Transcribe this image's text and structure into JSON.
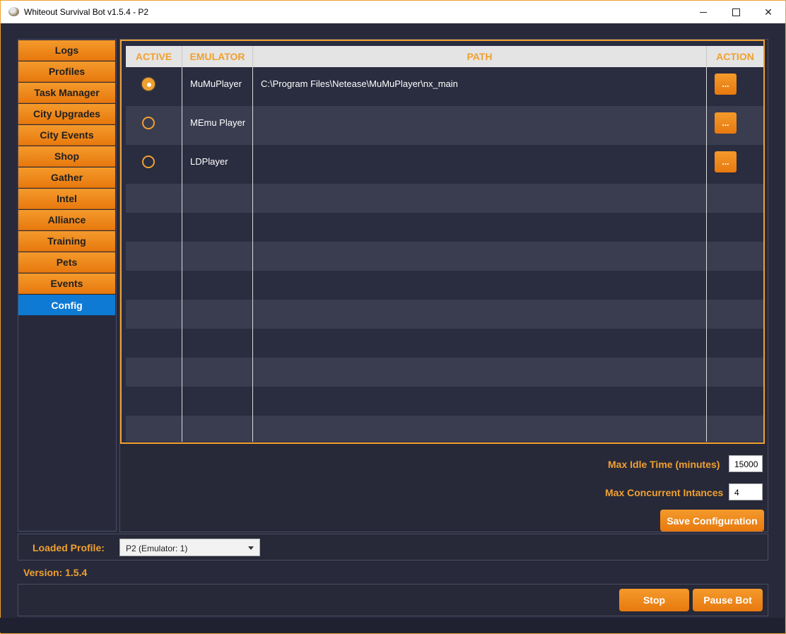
{
  "window": {
    "title": "Whiteout Survival Bot v1.5.4 - P2",
    "minimize_icon": "minimize-icon",
    "maximize_icon": "maximize-icon",
    "close_icon": "close-icon"
  },
  "sidebar": {
    "items": [
      {
        "label": "Logs",
        "active": false
      },
      {
        "label": "Profiles",
        "active": false
      },
      {
        "label": "Task Manager",
        "active": false
      },
      {
        "label": "City Upgrades",
        "active": false
      },
      {
        "label": "City Events",
        "active": false
      },
      {
        "label": "Shop",
        "active": false
      },
      {
        "label": "Gather",
        "active": false
      },
      {
        "label": "Intel",
        "active": false
      },
      {
        "label": "Alliance",
        "active": false
      },
      {
        "label": "Training",
        "active": false
      },
      {
        "label": "Pets",
        "active": false
      },
      {
        "label": "Events",
        "active": false
      },
      {
        "label": "Config",
        "active": true
      }
    ]
  },
  "table": {
    "headers": {
      "active": "ACTIVE",
      "emulator": "EMULATOR",
      "path": "PATH",
      "action": "ACTION"
    },
    "rows": [
      {
        "active": true,
        "emulator": "MuMuPlayer",
        "path": "C:\\Program Files\\Netease\\MuMuPlayer\\nx_main",
        "action": "..."
      },
      {
        "active": false,
        "emulator": "MEmu Player",
        "path": "",
        "action": "..."
      },
      {
        "active": false,
        "emulator": "LDPlayer",
        "path": "",
        "action": "..."
      }
    ]
  },
  "config": {
    "max_idle_label": "Max Idle Time (minutes)",
    "max_idle_value": "15000",
    "max_concurrent_label": "Max Concurrent Intances",
    "max_concurrent_value": "4",
    "save_button": "Save Configuration"
  },
  "profile": {
    "label": "Loaded Profile:",
    "selected": "P2 (Emulator: 1)"
  },
  "version": "Version: 1.5.4",
  "controls": {
    "stop": "Stop",
    "pause": "Pause Bot"
  },
  "colors": {
    "accent": "#f0a030",
    "active_nav": "#0e7ad4",
    "background": "#282a3c"
  }
}
